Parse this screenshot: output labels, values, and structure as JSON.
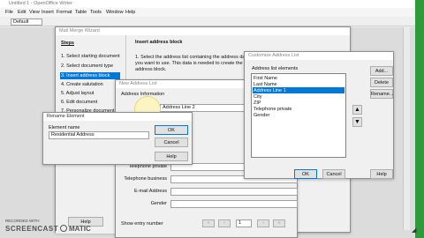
{
  "app": {
    "title": "Untitled 1 - OpenOffice Writer"
  },
  "menu": [
    "File",
    "Edit",
    "View",
    "Insert",
    "Format",
    "Table",
    "Tools",
    "Window",
    "Help"
  ],
  "toolbar": {
    "style_value": "Default"
  },
  "wizard": {
    "title": "Mail Merge Wizard",
    "steps_heading": "Steps",
    "steps": [
      "1. Select starting document",
      "2. Select document type",
      "3. Insert address block",
      "4. Create salutation",
      "5. Adjust layout",
      "6. Edit document",
      "7. Personalize document"
    ],
    "section_heading": "Insert address block",
    "instruction": "1. Select the address list containing the address data you want to use. This data is needed to create the address block.",
    "help_label": "Help"
  },
  "address_list": {
    "title": "New Address List",
    "heading": "Address Information",
    "first_field_value": "Address Line 2",
    "fields": [
      "Telephone private",
      "Telephone business",
      "E-mail Address",
      "Gender"
    ],
    "show_entry_label": "Show entry number",
    "entry_number": "1"
  },
  "customize": {
    "title": "Customize Address List",
    "list_label": "Address list elements",
    "items": [
      "First Name",
      "Last Name",
      "Address Line 1",
      "City",
      "ZIP",
      "Telephone private",
      "Gender"
    ],
    "selected_item": "Address Line 1",
    "add_label": "Add...",
    "delete_label": "Delete",
    "rename_label": "Rename...",
    "ok_label": "OK",
    "cancel_label": "Cancel",
    "help_label": "Help"
  },
  "rename": {
    "title": "Rename Element",
    "name_label": "Element name",
    "name_value": "Residential Address",
    "ok_label": "OK",
    "cancel_label": "Cancel",
    "help_label": "Help"
  },
  "watermark": {
    "line1": "RECORDED WITH",
    "line2": "SCREENCAST",
    "line3": "MATIC"
  },
  "colors": {
    "selection": "#0078d7",
    "highlight_circle": "#fff6b8",
    "titlebar_green": "#1e8f2e"
  }
}
